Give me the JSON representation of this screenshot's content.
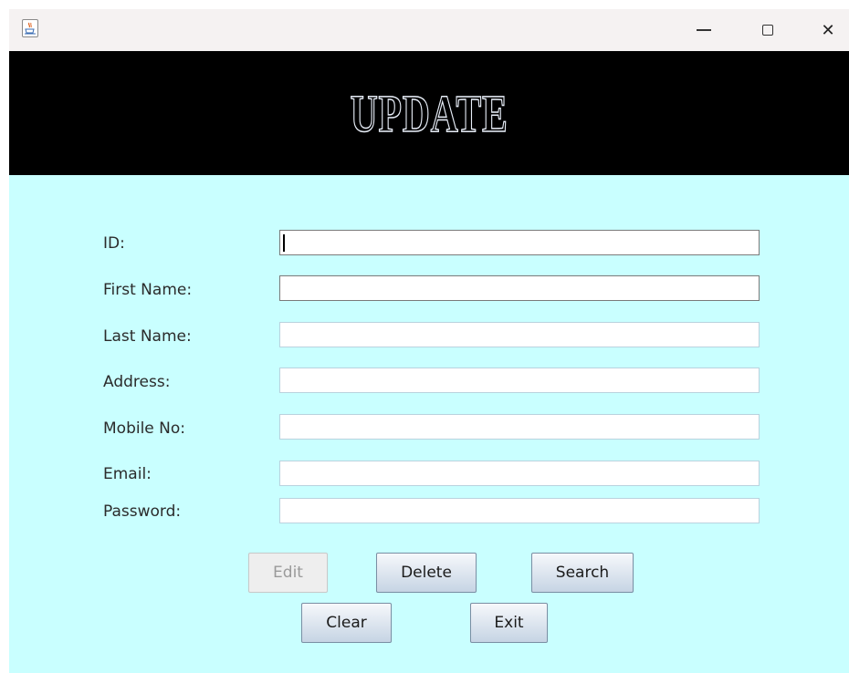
{
  "window": {
    "title": "",
    "icons": {
      "app": "java-cup-icon",
      "minimize": "minimize-icon",
      "maximize": "maximize-icon",
      "close": "close-icon"
    },
    "close_glyph": "✕"
  },
  "header": {
    "title": "UPDATE"
  },
  "colors": {
    "background": "#c9ffff",
    "header": "#000000",
    "field_border": "#b9d2de"
  },
  "form": {
    "fields": [
      {
        "label": "ID:",
        "value": "",
        "focused": true
      },
      {
        "label": "First Name:",
        "value": ""
      },
      {
        "label": "Last Name:",
        "value": ""
      },
      {
        "label": "Address:",
        "value": ""
      },
      {
        "label": "Mobile No:",
        "value": ""
      },
      {
        "label": "Email:",
        "value": ""
      },
      {
        "label": "Password:",
        "value": ""
      }
    ]
  },
  "buttons": {
    "edit": "Edit",
    "delete": "Delete",
    "search": "Search",
    "clear": "Clear",
    "exit": "Exit"
  }
}
